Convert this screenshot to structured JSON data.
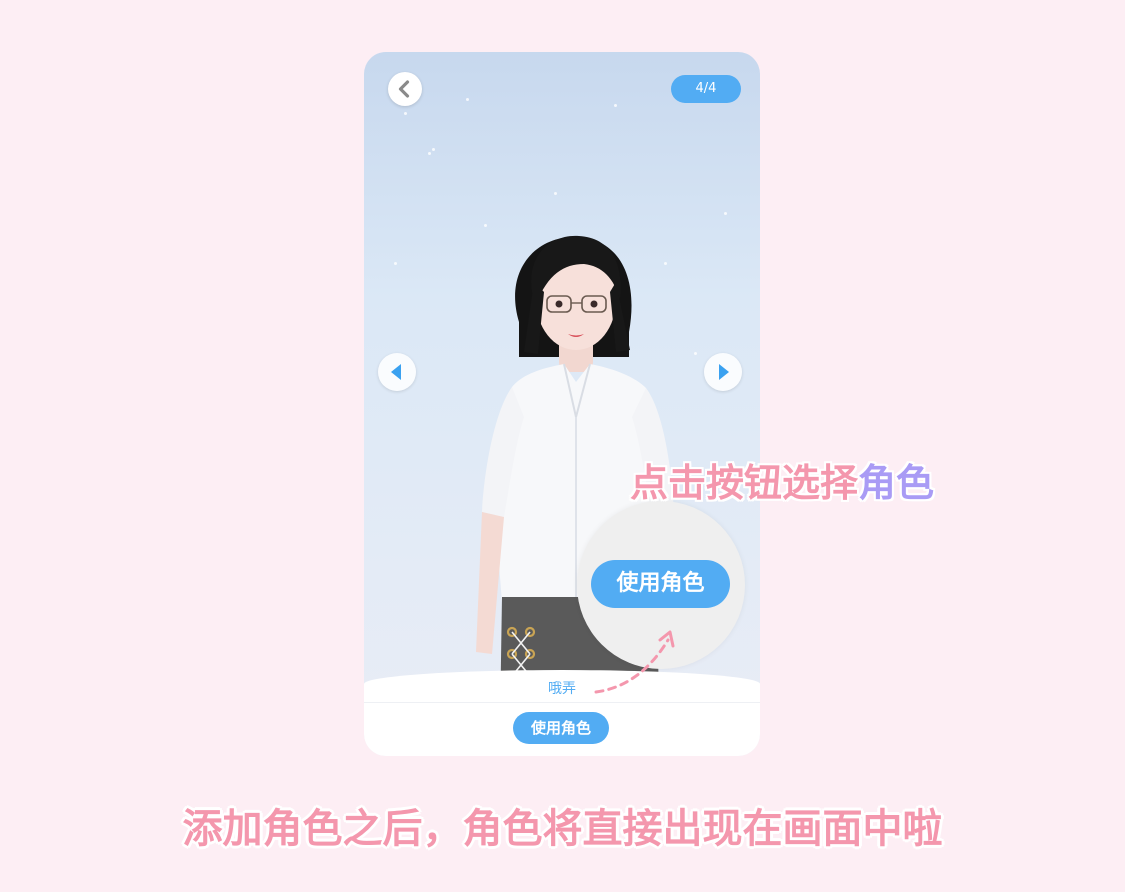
{
  "screen": {
    "page_indicator": "4/4",
    "character_name": "哦弄",
    "use_character_button": "使用角色"
  },
  "zoom": {
    "use_character_button": "使用角色"
  },
  "callout": {
    "text_main": "点击按钮选择",
    "text_accent": "角色"
  },
  "caption": "添加角色之后，角色将直接出现在画面中啦",
  "colors": {
    "accent_blue": "#52acf3",
    "pink_text": "#f497ad",
    "purple_text": "#a99bf5",
    "page_background": "#fdeef4"
  },
  "icons": {
    "back": "chevron-left-icon",
    "prev": "triangle-left-icon",
    "next": "triangle-right-icon"
  }
}
